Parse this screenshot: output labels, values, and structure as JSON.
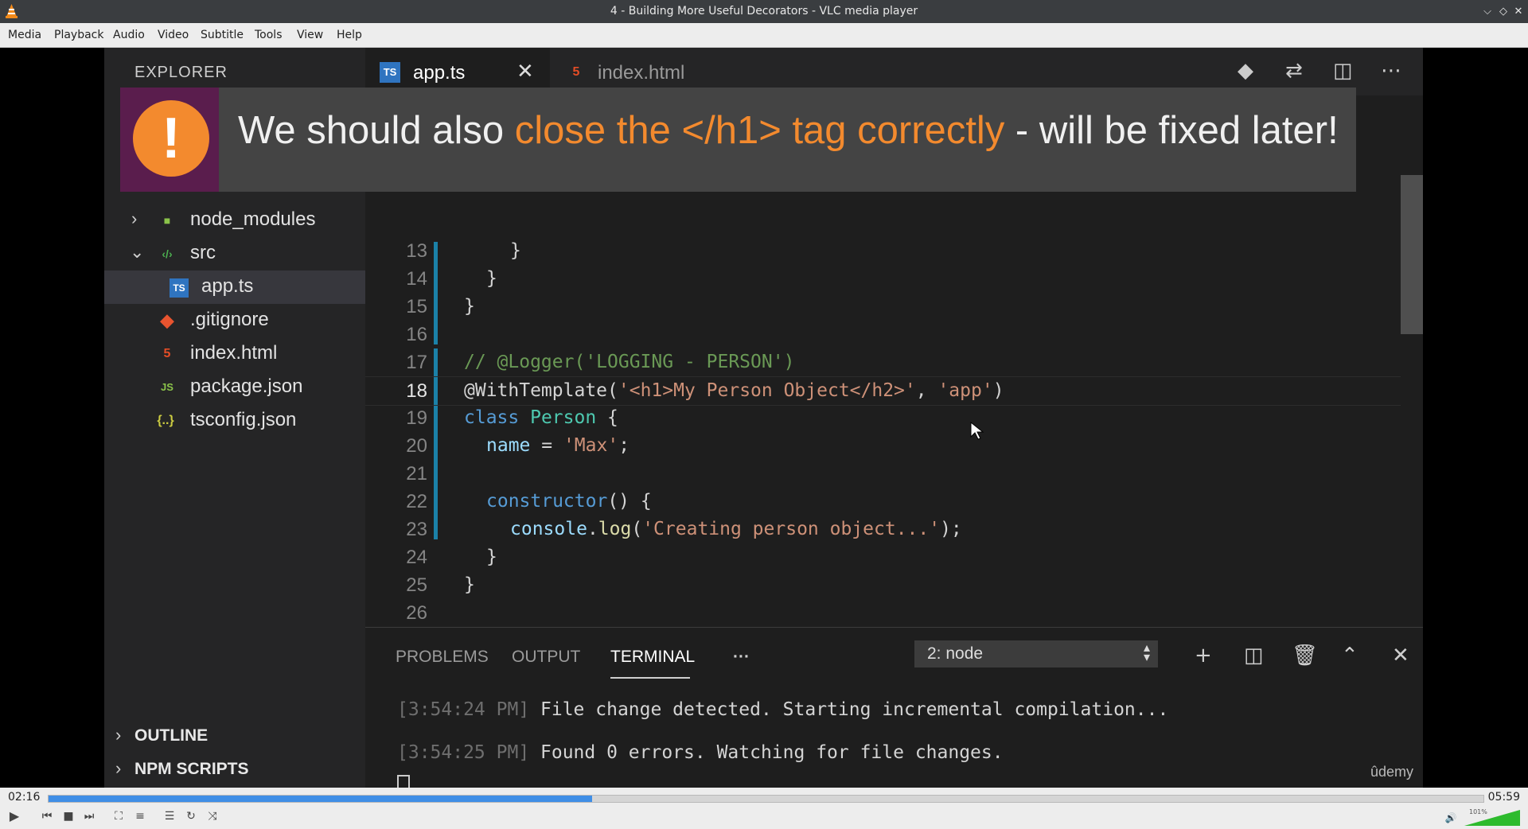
{
  "window": {
    "title": "4 - Building More Useful Decorators - VLC media player"
  },
  "menu": [
    "Media",
    "Playback",
    "Audio",
    "Video",
    "Subtitle",
    "Tools",
    "View",
    "Help"
  ],
  "ide": {
    "explorer_title": "EXPLORER",
    "tabs": [
      {
        "label": "app.ts",
        "icon": "TS"
      },
      {
        "label": "index.html",
        "icon": "5"
      }
    ],
    "tree": [
      {
        "label": "node_modules"
      },
      {
        "label": "src"
      },
      {
        "label": "app.ts"
      },
      {
        "label": ".gitignore"
      },
      {
        "label": "index.html"
      },
      {
        "label": "package.json"
      },
      {
        "label": "tsconfig.json"
      }
    ],
    "sections": [
      "OUTLINE",
      "NPM SCRIPTS"
    ],
    "lines": [
      "13",
      "14",
      "15",
      "16",
      "17",
      "18",
      "19",
      "20",
      "21",
      "22",
      "23",
      "24",
      "25",
      "26"
    ],
    "code": {
      "l13": "}",
      "l14": "}",
      "l15": "}",
      "l17": "// @Logger('LOGGING - PERSON')",
      "l18_a": "@WithTemplate(",
      "l18_b": "'<h1>My Person Object</h2>'",
      "l18_c": ", ",
      "l18_d": "'app'",
      "l18_e": ")",
      "l19_kw": "class",
      "l19_cls": "Person",
      "l19_rest": " {",
      "l20_prop": "name",
      "l20_eq": " = ",
      "l20_str": "'Max'",
      "l20_end": ";",
      "l22_kw": "constructor",
      "l22_rest": "() {",
      "l23_obj": "console",
      "l23_dot": ".",
      "l23_fn": "log",
      "l23_open": "(",
      "l23_str": "'Creating person object...'",
      "l23_end": ");",
      "l24": "}",
      "l25": "}"
    },
    "banner": {
      "icon": "!",
      "part1": "We should also ",
      "highlight": "close the </h1> tag correctly",
      "part2": " - will be fixed later!"
    },
    "panel": {
      "tabs": [
        "PROBLEMS",
        "OUTPUT",
        "TERMINAL",
        "···"
      ],
      "active_tab": "TERMINAL",
      "terminal_select": "2: node",
      "lines": [
        {
          "ts": "[3:54:24 PM]",
          "text": " File change detected. Starting incremental compilation..."
        },
        {
          "ts": "[3:54:25 PM]",
          "text": " Found 0 errors. Watching for file changes."
        }
      ]
    },
    "watermark": "ûdemy"
  },
  "player": {
    "elapsed": "02:16",
    "total": "05:59",
    "progress_fraction": 0.379,
    "volume_label": "101%",
    "volume_fraction": 1.0
  },
  "colors": {
    "accent_orange": "#f38a2e",
    "seek_fill": "#3f8ee6",
    "volume_fill": "#2dbb2d"
  }
}
